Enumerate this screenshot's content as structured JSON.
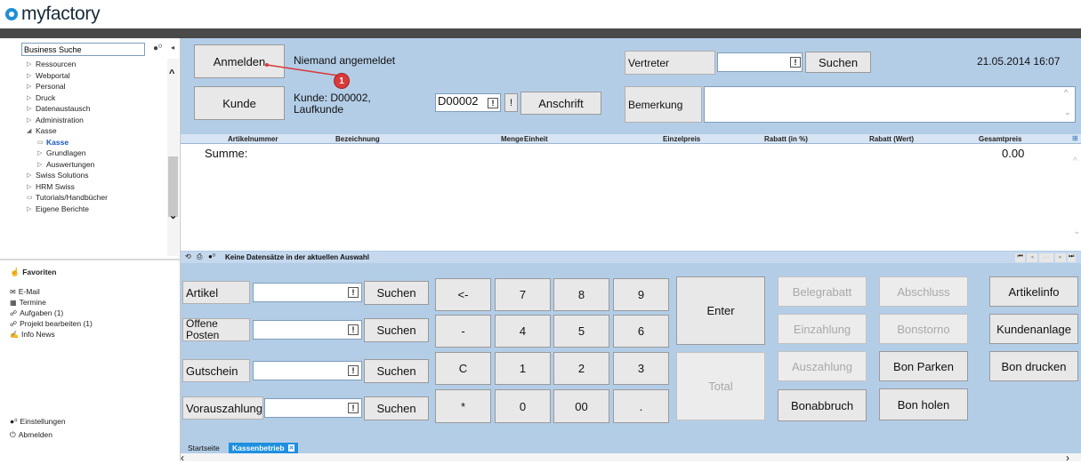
{
  "app": {
    "logo": "myfactory"
  },
  "sidebar": {
    "search_value": "Business Suche",
    "tree": [
      {
        "label": "Ressourcen",
        "icon": "tri-right",
        "sel": false,
        "indent": 0
      },
      {
        "label": "Webportal",
        "icon": "tri-right",
        "sel": false,
        "indent": 0
      },
      {
        "label": "Personal",
        "icon": "tri-right",
        "sel": false,
        "indent": 0
      },
      {
        "label": "Druck",
        "icon": "tri-right",
        "sel": false,
        "indent": 0
      },
      {
        "label": "Datenaustausch",
        "icon": "tri-right",
        "sel": false,
        "indent": 0
      },
      {
        "label": "Administration",
        "icon": "tri-right",
        "sel": false,
        "indent": 0
      },
      {
        "label": "Kasse",
        "icon": "tri-down",
        "sel": false,
        "indent": 0
      },
      {
        "label": "Kasse",
        "icon": "doc",
        "sel": true,
        "indent": 1
      },
      {
        "label": "Grundlagen",
        "icon": "tri-right",
        "sel": false,
        "indent": 1
      },
      {
        "label": "Auswertungen",
        "icon": "tri-right",
        "sel": false,
        "indent": 1
      },
      {
        "label": "Swiss Solutions",
        "icon": "tri-right",
        "sel": false,
        "indent": 0
      },
      {
        "label": "HRM Swiss",
        "icon": "tri-right",
        "sel": false,
        "indent": 0
      },
      {
        "label": "Tutorials/Handbücher",
        "icon": "doc",
        "sel": false,
        "indent": 0
      },
      {
        "label": "Eigene Berichte",
        "icon": "tri-right",
        "sel": false,
        "indent": 0
      }
    ],
    "favoriten": "Favoriten",
    "links": [
      "E-Mail",
      "Termine",
      "Aufgaben (1)",
      "Projekt bearbeiten (1)",
      "Info News"
    ],
    "einstellungen": "Einstellungen",
    "abmelden": "Abmelden"
  },
  "header": {
    "anmelden": "Anmelden",
    "status": "Niemand angemeldet",
    "kunde": "Kunde",
    "kunde_info_1": "Kunde: D00002,",
    "kunde_info_2": "Laufkunde",
    "kunde_nr": "D00002",
    "excl": "!",
    "anschrift": "Anschrift",
    "vertreter": "Vertreter",
    "suchen": "Suchen",
    "datetime": "21.05.2014 16:07",
    "bemerkung": "Bemerkung",
    "marker": "1"
  },
  "grid": {
    "columns": [
      "Artikelnummer",
      "Bezeichnung",
      "Menge",
      "Einheit",
      "Einzelpreis",
      "Rabatt (in %)",
      "Rabatt (Wert)",
      "Gesamtpreis"
    ],
    "summe_label": "Summe:",
    "summe_value": "0.00",
    "footer": "Keine Datensätze in der aktuellen Auswahl"
  },
  "search_rows": [
    {
      "label": "Artikel",
      "button": "Suchen"
    },
    {
      "label": "Offene Posten",
      "button": "Suchen"
    },
    {
      "label": "Gutschein",
      "button": "Suchen"
    },
    {
      "label": "Vorauszahlung",
      "button": "Suchen"
    }
  ],
  "keypad": [
    "<-",
    "7",
    "8",
    "9",
    "-",
    "4",
    "5",
    "6",
    "C",
    "1",
    "2",
    "3",
    "*",
    "0",
    "00",
    "."
  ],
  "enter": "Enter",
  "total": "Total",
  "functions": {
    "belegrabatt": "Belegrabatt",
    "abschluss": "Abschluss",
    "artikelinfo": "Artikelinfo",
    "einzahlung": "Einzahlung",
    "bonstorno": "Bonstorno",
    "kundenanlage": "Kundenanlage",
    "auszahlung": "Auszahlung",
    "bon_parken": "Bon Parken",
    "bon_drucken": "Bon drucken",
    "bonabbruch": "Bonabbruch",
    "bon_holen": "Bon holen"
  },
  "tabs": [
    "Startseite",
    "Kassenbetrieb"
  ],
  "colors": {
    "main_bg": "#b3cde7",
    "accent": "#1e8fd6",
    "marker": "#d93a3a",
    "active_tab": "#1f8fe0"
  }
}
